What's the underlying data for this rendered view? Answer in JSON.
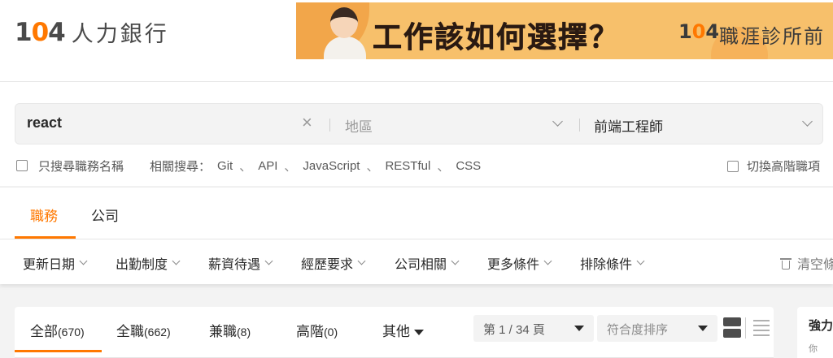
{
  "brand": {
    "logo_number_a": "1",
    "logo_number_o": "0",
    "logo_number_b": "4",
    "logo_text": "人力銀行"
  },
  "banner": {
    "headline": "工作該如何選擇？",
    "logo_number_a": "1",
    "logo_number_o": "0",
    "logo_number_b": "4",
    "subtitle": "職涯診所",
    "subtitle_cut": "前"
  },
  "search": {
    "keyword": "react",
    "clear_symbol": "×",
    "area_placeholder": "地區",
    "job_category": "前端工程師",
    "title_only_label": "只搜尋職務名稱",
    "related_label": "相關搜尋：",
    "related_terms": [
      "Git",
      "API",
      "JavaScript",
      "RESTful",
      "CSS"
    ],
    "separator": "、",
    "advanced_label": "切換高階職項"
  },
  "main_tabs": [
    {
      "label": "職務",
      "active": true
    },
    {
      "label": "公司",
      "active": false
    }
  ],
  "filters": [
    "更新日期",
    "出勤制度",
    "薪資待遇",
    "經歷要求",
    "公司相關",
    "更多條件",
    "排除條件"
  ],
  "clear_filters_label": "清空條件",
  "results": {
    "tabs": [
      {
        "label": "全部",
        "count": "(670)",
        "active": true
      },
      {
        "label": "全職",
        "count": "(662)",
        "active": false
      },
      {
        "label": "兼職",
        "count": "(8)",
        "active": false
      },
      {
        "label": "高階",
        "count": "(0)",
        "active": false
      },
      {
        "label": "其他",
        "count": "",
        "active": false
      }
    ],
    "page_select": "第 1 / 34 頁",
    "sort_select": "符合度排序"
  },
  "side_panel": {
    "title": "強力",
    "subtitle": "你"
  },
  "colors": {
    "accent": "#ff7800",
    "text": "#292929",
    "muted": "#8a8a8a",
    "banner_bg": "#f7c06b"
  }
}
